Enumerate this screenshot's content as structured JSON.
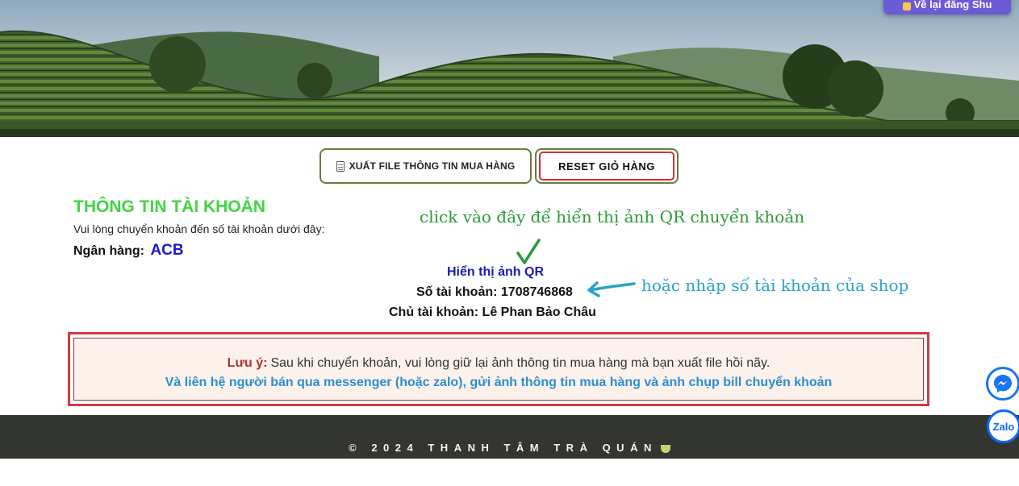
{
  "header": {
    "back_button_label": "Về lại đăng Shu"
  },
  "actions": {
    "export_label": "XUẤT FILE THÔNG TIN MUA HÀNG",
    "reset_label": "RESET GIỎ HÀNG"
  },
  "account": {
    "title": "THÔNG TIN TÀI KHOẢN",
    "subtitle": "Vui lòng chuyển khoản đến số tài khoản dưới đây:",
    "bank_label": "Ngân hàng:",
    "bank_value": "ACB",
    "qr_link": "Hiển thị ảnh QR",
    "account_number": "Số tài khoản: 1708746868",
    "account_holder": "Chủ tài khoản: Lê Phan Bảo Châu"
  },
  "annotations": {
    "qr_hint": "click vào đây để hiển thị ảnh QR chuyển khoản",
    "account_hint": "hoặc nhập số tài khoản của shop"
  },
  "note": {
    "label": "Lưu ý:",
    "text": "Sau khi chuyển khoản, vui lòng giữ lại ảnh thông tin mua hàng mà bạn xuất file hồi nãy.",
    "contact": "Và liên hệ người bán qua messenger (hoặc zalo), gửi ảnh thông tin mua hàng và ảnh chụp bill chuyển khoản"
  },
  "footer": {
    "copyright": "© 2024 THANH TÂM TRÀ QUÁN"
  },
  "floating": {
    "zalo_label": "Zalo"
  },
  "icons": {
    "export": "document-icon",
    "qr_hint_marker": "checkmark-icon",
    "account_hint_marker": "arrow-left-icon",
    "messenger": "messenger-icon",
    "zalo": "zalo-icon",
    "footer_cup": "tea-cup-icon"
  },
  "colors": {
    "title_green": "#41d441",
    "bank_blue": "#1919c8",
    "qr_link_blue": "#1a1ab5",
    "note_border_red": "#d23a44",
    "note_label_red": "#b0302e",
    "contact_blue": "#2a8fd0",
    "footer_bg": "#333530",
    "hint_green": "#2a9a38",
    "hint_cyan": "#2aa3c6"
  }
}
